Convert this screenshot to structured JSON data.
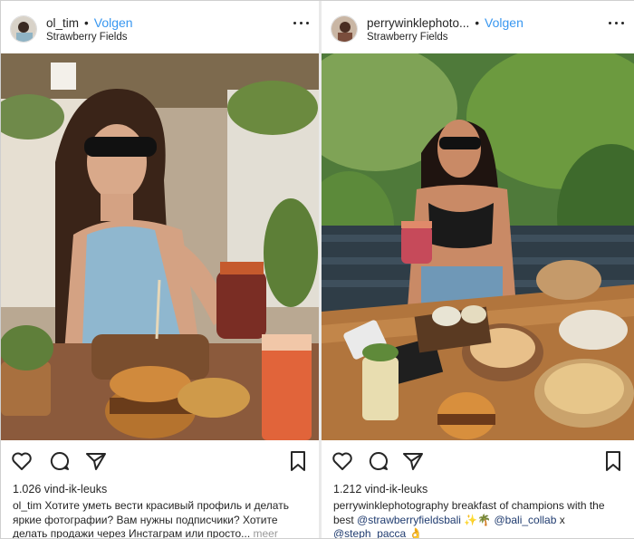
{
  "left_post": {
    "username": "ol_tim",
    "separator": "•",
    "follow_label": "Volgen",
    "location": "Strawberry Fields",
    "likes": "1.026 vind-ik-leuks",
    "caption_user": "ol_tim",
    "caption_text": "Хотите уметь вести красивый профиль и делать яркие фотографии? Вам нужны подписчики? Хотите делать продажи через Инстаграм или просто...",
    "caption_more": "meer"
  },
  "right_post": {
    "username": "perrywinklephoto...",
    "separator": "•",
    "follow_label": "Volgen",
    "location": "Strawberry Fields",
    "likes": "1.212 vind-ik-leuks",
    "caption_user": "perrywinklephotography",
    "caption_text_1": "breakfast of champions with the best",
    "caption_tag_1": "@strawberryfieldsbali",
    "caption_emoji_1": "✨🌴",
    "caption_tag_2": "@bali_collab",
    "caption_text_2": "x",
    "caption_tag_3": "@steph_pacca",
    "caption_emoji_2": "👌"
  },
  "icons": {
    "like": "heart-icon",
    "comment": "comment-icon",
    "share": "paper-plane-icon",
    "save": "bookmark-icon",
    "more": "more-dots-icon"
  },
  "colors": {
    "follow": "#3897f0",
    "text": "#262626",
    "mention": "#1f3b6f"
  }
}
